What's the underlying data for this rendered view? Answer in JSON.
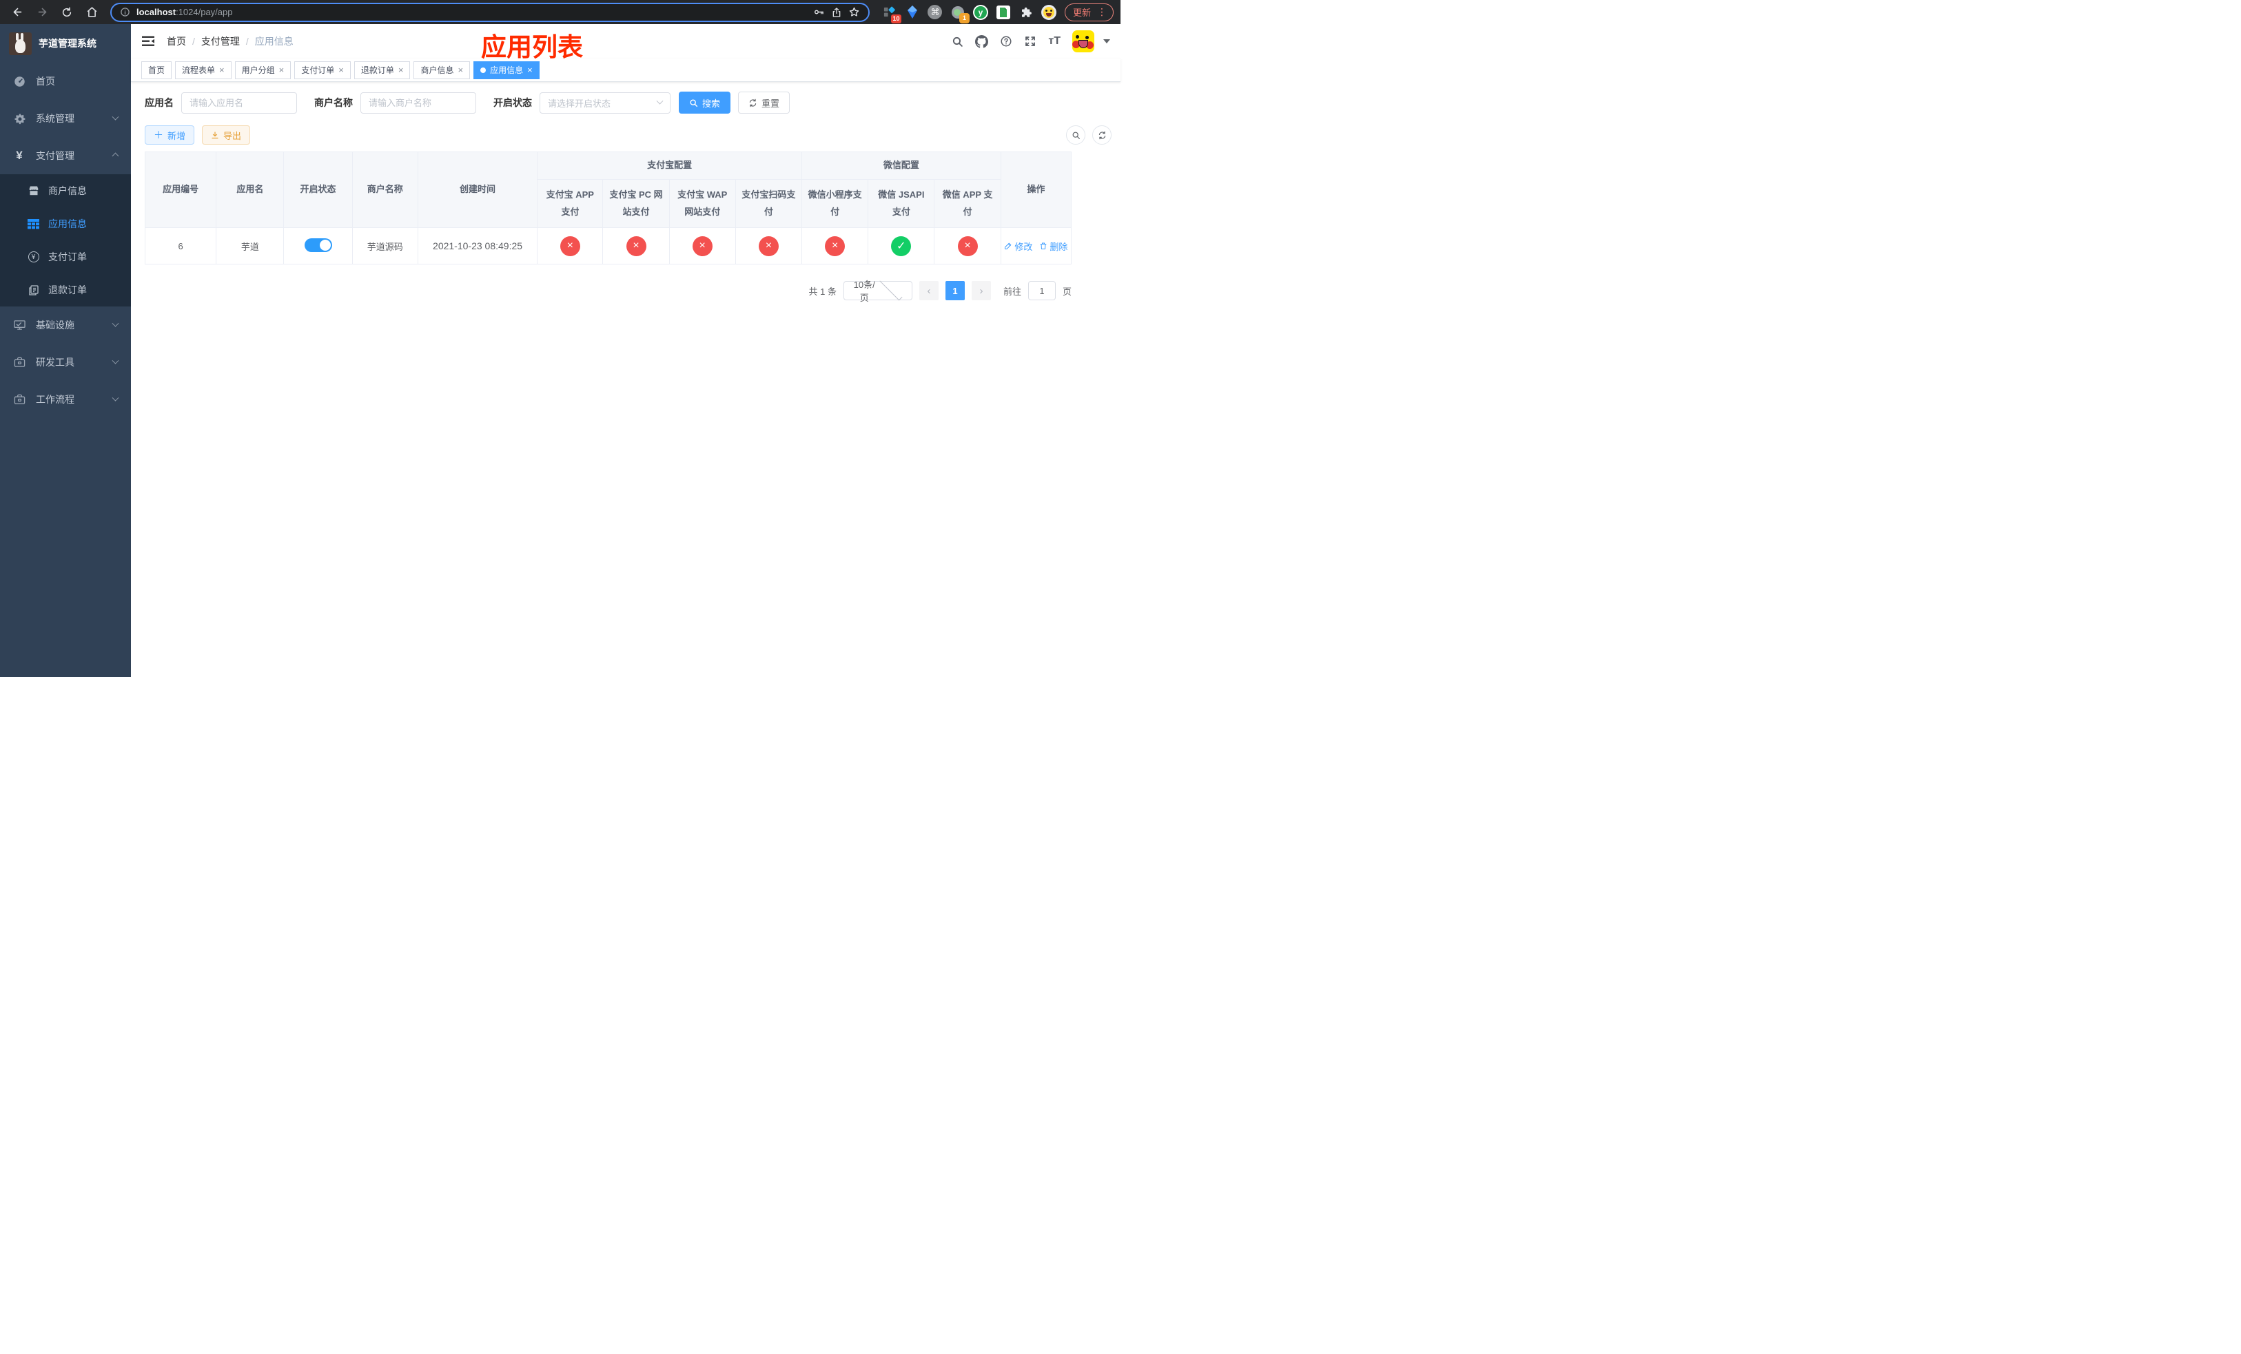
{
  "browser": {
    "url_host": "localhost",
    "url_rest": ":1024/pay/app",
    "update_label": "更新",
    "ext_badge_blocks": "10",
    "ext_badge_meet": "1",
    "ext_y_label": "y"
  },
  "annotation": {
    "title": "应用列表"
  },
  "sidebar": {
    "logo_title": "芋道管理系统",
    "items": [
      {
        "label": "首页"
      },
      {
        "label": "系统管理"
      },
      {
        "label": "支付管理"
      },
      {
        "label": "商户信息"
      },
      {
        "label": "应用信息"
      },
      {
        "label": "支付订单"
      },
      {
        "label": "退款订单"
      },
      {
        "label": "基础设施"
      },
      {
        "label": "研发工具"
      },
      {
        "label": "工作流程"
      }
    ]
  },
  "breadcrumb": {
    "items": [
      "首页",
      "支付管理",
      "应用信息"
    ]
  },
  "tabs": [
    {
      "label": "首页"
    },
    {
      "label": "流程表单"
    },
    {
      "label": "用户分组"
    },
    {
      "label": "支付订单"
    },
    {
      "label": "退款订单"
    },
    {
      "label": "商户信息"
    },
    {
      "label": "应用信息"
    }
  ],
  "filters": {
    "app_name_label": "应用名",
    "app_name_placeholder": "请输入应用名",
    "merchant_label": "商户名称",
    "merchant_placeholder": "请输入商户名称",
    "status_label": "开启状态",
    "status_placeholder": "请选择开启状态",
    "search_label": "搜索",
    "reset_label": "重置"
  },
  "toolbar": {
    "add_label": "新增",
    "export_label": "导出"
  },
  "table": {
    "group_headers": {
      "alipay": "支付宝配置",
      "wechat": "微信配置"
    },
    "columns": [
      "应用编号",
      "应用名",
      "开启状态",
      "商户名称",
      "创建时间",
      "支付宝 APP 支付",
      "支付宝 PC 网站支付",
      "支付宝 WAP 网站支付",
      "支付宝扫码支付",
      "微信小程序支付",
      "微信 JSAPI 支付",
      "微信 APP 支付",
      "操作"
    ],
    "row": {
      "id": "6",
      "name": "芋道",
      "enabled": true,
      "merchant": "芋道源码",
      "created": "2021-10-23 08:49:25",
      "statuses": [
        {
          "state": "fail",
          "glyph": "×"
        },
        {
          "state": "fail",
          "glyph": "×"
        },
        {
          "state": "fail",
          "glyph": "×"
        },
        {
          "state": "fail",
          "glyph": "×"
        },
        {
          "state": "fail",
          "glyph": "×"
        },
        {
          "state": "success",
          "glyph": "✓"
        },
        {
          "state": "fail",
          "glyph": "×"
        }
      ],
      "edit_label": "修改",
      "delete_label": "删除"
    }
  },
  "pagination": {
    "total_text": "共 1 条",
    "page_size": "10条/页",
    "current_page": "1",
    "goto_label": "前往",
    "goto_value": "1",
    "page_suffix": "页"
  },
  "colors": {
    "accent": "#409eff",
    "fail": "#f3514f",
    "success": "#13ce66",
    "annotation": "#ff2b00"
  }
}
